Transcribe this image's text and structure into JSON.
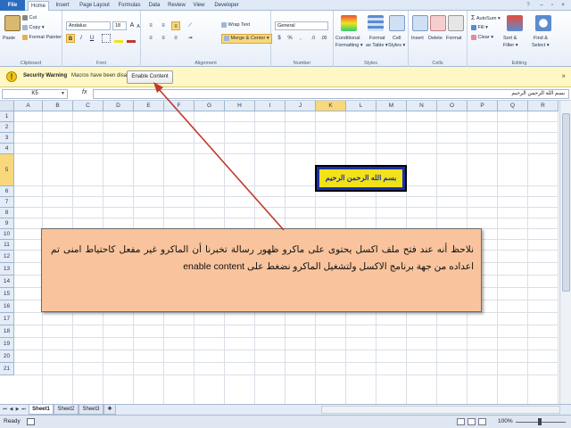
{
  "ribbon_tabs": [
    "File",
    "Home",
    "Insert",
    "Page Layout",
    "Formulas",
    "Data",
    "Review",
    "View",
    "Developer"
  ],
  "clipboard": {
    "paste": "Paste",
    "cut": "Cut",
    "copy": "Copy ▾",
    "format_painter": "Format Painter",
    "label": "Clipboard"
  },
  "font": {
    "name": "Andalus",
    "size": "18",
    "grow": "A",
    "shrink": "A",
    "bold": "B",
    "italic": "I",
    "underline": "U",
    "label": "Font"
  },
  "alignment": {
    "wrap_text": "Wrap Text",
    "merge_center": "Merge & Center ▾",
    "label": "Alignment"
  },
  "number": {
    "format": "General",
    "currency": "$",
    "percent": "%",
    "comma": ",",
    "label": "Number"
  },
  "styles": {
    "conditional": "Conditional",
    "formatting": "Formatting ▾",
    "format_as": "Format",
    "as_table": "as Table ▾",
    "cell": "Cell",
    "styles_btn": "Styles ▾",
    "label": "Styles"
  },
  "cells": {
    "insert": "Insert",
    "delete": "Delete",
    "format": "Format",
    "label": "Cells"
  },
  "editing": {
    "autosum": "AutoSum ▾",
    "fill": "Fill ▾",
    "clear": "Clear ▾",
    "sort": "Sort &",
    "filter": "Filter ▾",
    "find": "Find &",
    "select": "Select ▾",
    "label": "Editing"
  },
  "security": {
    "title": "Security Warning",
    "message": "Macros have been disabled.",
    "button": "Enable Content",
    "close": "×"
  },
  "formula_bar": {
    "name_box": "K5",
    "fx": "fx",
    "content": "بسم الله الرحمن الرحيم"
  },
  "columns": [
    "A",
    "B",
    "C",
    "D",
    "E",
    "F",
    "G",
    "H",
    "I",
    "J",
    "K",
    "L",
    "M",
    "N",
    "O",
    "P",
    "Q",
    "R"
  ],
  "selected_column": "K",
  "rows": [
    "1",
    "2",
    "3",
    "4",
    "5",
    "6",
    "7",
    "8",
    "9",
    "10",
    "11",
    "12",
    "13",
    "14",
    "15",
    "16",
    "17",
    "18",
    "19",
    "20",
    "21"
  ],
  "selected_row": "5",
  "cell_k5": "بسم الله الرحمن الرحيم",
  "callout_text": "نلاحظ أنه عند فتح ملف اكسل يحتوى على ماكرو ظهور رسالة تخبرنا أن الماكرو غير مفعل كاحتياط امنى تم اعداده من جهة برنامج الاكسل ولتشغيل الماكرو نضغط على enable content",
  "sheets": [
    "Sheet1",
    "Sheet2",
    "Sheet3"
  ],
  "active_sheet": "Sheet1",
  "status": {
    "ready": "Ready",
    "zoom": "100%"
  },
  "colors": {
    "ribbon_bg": "#dfe9f5",
    "file_tab": "#2a6dc0",
    "security_bg": "#fff8c4",
    "callout_bg": "#f9c49d",
    "arrow": "#c0392b",
    "k5_border": "#1a2fa8",
    "k5_fill": "#f2e21a"
  }
}
